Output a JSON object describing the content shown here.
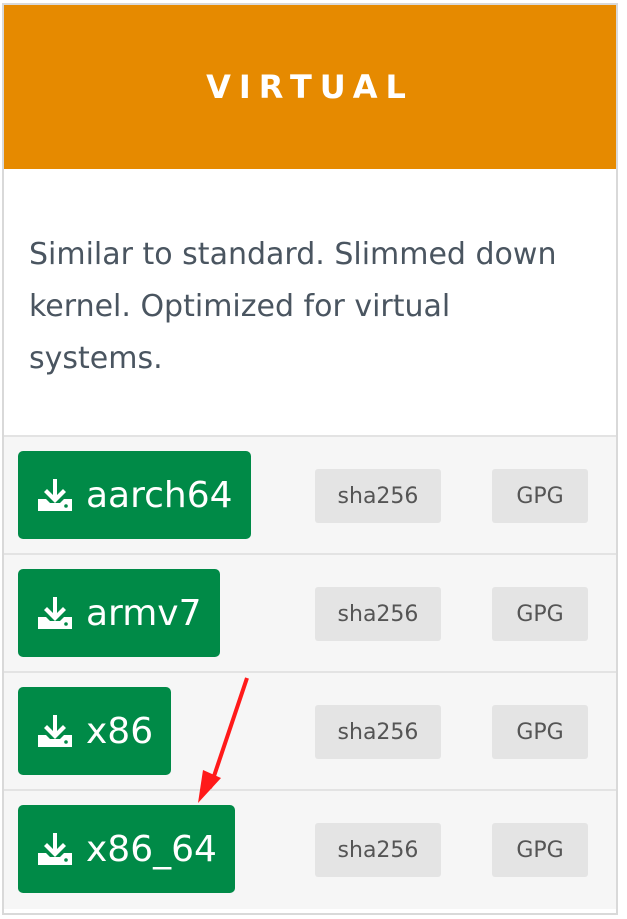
{
  "card": {
    "title": "VIRTUAL",
    "description": "Similar to standard. Slimmed down kernel. Optimized for virtual systems.",
    "header_color": "#e68a00",
    "button_color": "#008a47"
  },
  "downloads": [
    {
      "arch": "aarch64",
      "sha": "sha256",
      "gpg": "GPG"
    },
    {
      "arch": "armv7",
      "sha": "sha256",
      "gpg": "GPG"
    },
    {
      "arch": "x86",
      "sha": "sha256",
      "gpg": "GPG"
    },
    {
      "arch": "x86_64",
      "sha": "sha256",
      "gpg": "GPG"
    }
  ],
  "annotation": {
    "arrow_color": "#ff1a1a",
    "points_to": "x86_64"
  }
}
